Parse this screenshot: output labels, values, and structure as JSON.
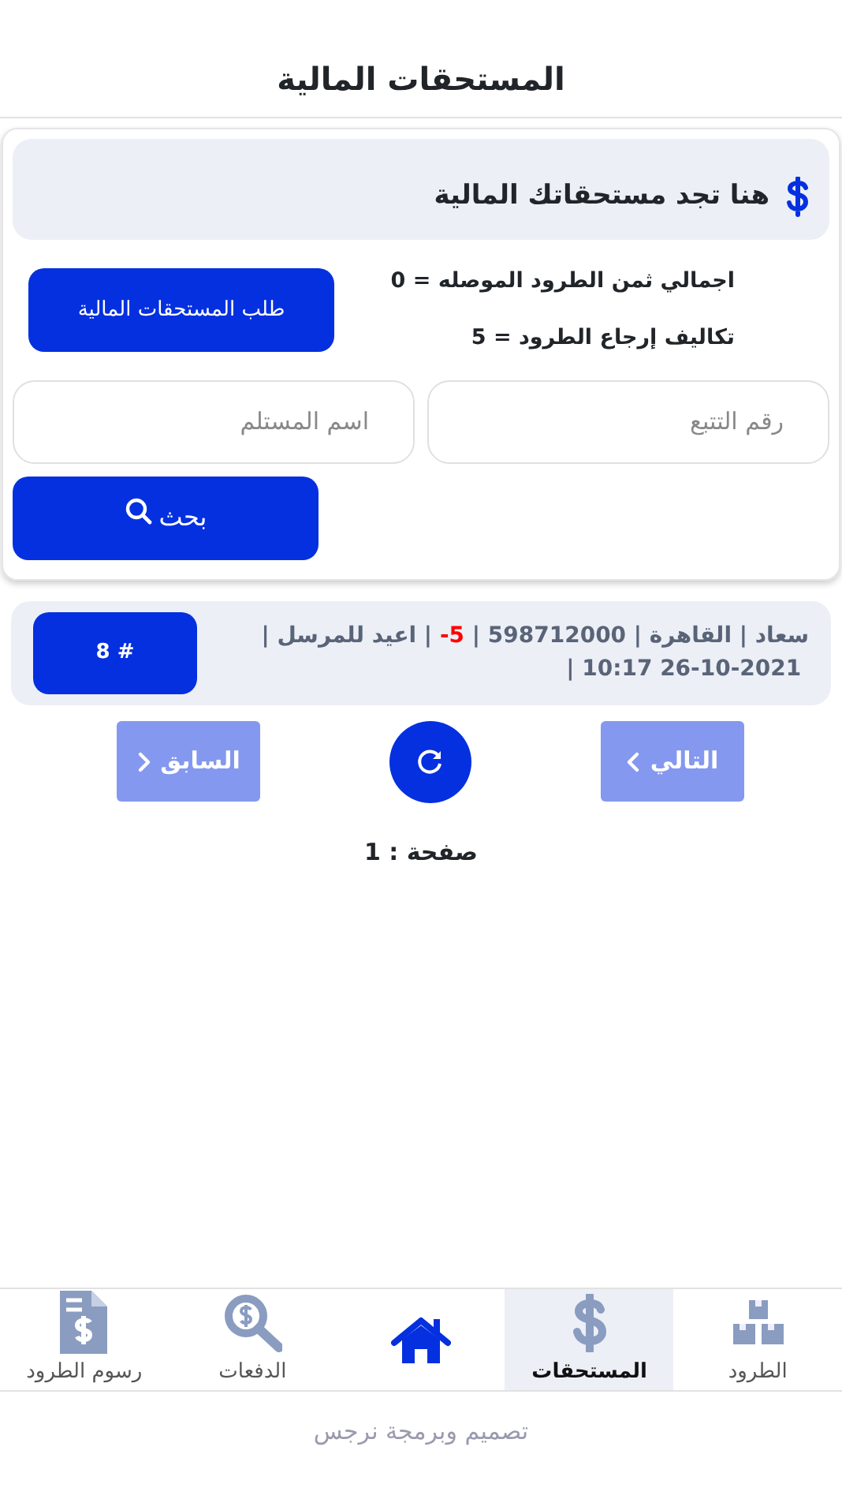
{
  "title": "المستحقات المالية",
  "summary": {
    "heading": "هنا تجد مستحقاتك المالية",
    "lines": [
      "اجمالي ثمن الطرود الموصله = 0",
      "تكاليف إرجاع الطرود = 5"
    ],
    "request_button": "طلب المستحقات المالية"
  },
  "search": {
    "fields": [
      {
        "placeholder": "رقم التتبع"
      },
      {
        "placeholder": "اسم المستلم"
      }
    ],
    "button": "بحث"
  },
  "items": [
    {
      "number": "# 8",
      "separator": "|",
      "parts": [
        {
          "text": "سعاد",
          "kind": "plain"
        },
        {
          "text": "القاهرة",
          "kind": "plain"
        },
        {
          "text": "598712000",
          "kind": "plain"
        },
        {
          "text": "-5",
          "kind": "amount"
        },
        {
          "text": "اعيد للمرسل",
          "kind": "plain"
        },
        {
          "text": "10:17 26-10-2021",
          "kind": "plain"
        }
      ]
    }
  ],
  "pagination": {
    "next": "التالي",
    "previous": "السابق",
    "page": "صفحة : 1"
  },
  "bottom_nav": [
    {
      "label": "الطرود",
      "selected": false
    },
    {
      "label": "المستحقات",
      "selected": true
    },
    {
      "selected": false
    },
    {
      "label": "الدفعات",
      "selected": false
    },
    {
      "label": "رسوم الطرود",
      "selected": false
    }
  ],
  "footer": "تصميم وبرمجة نرجس"
}
